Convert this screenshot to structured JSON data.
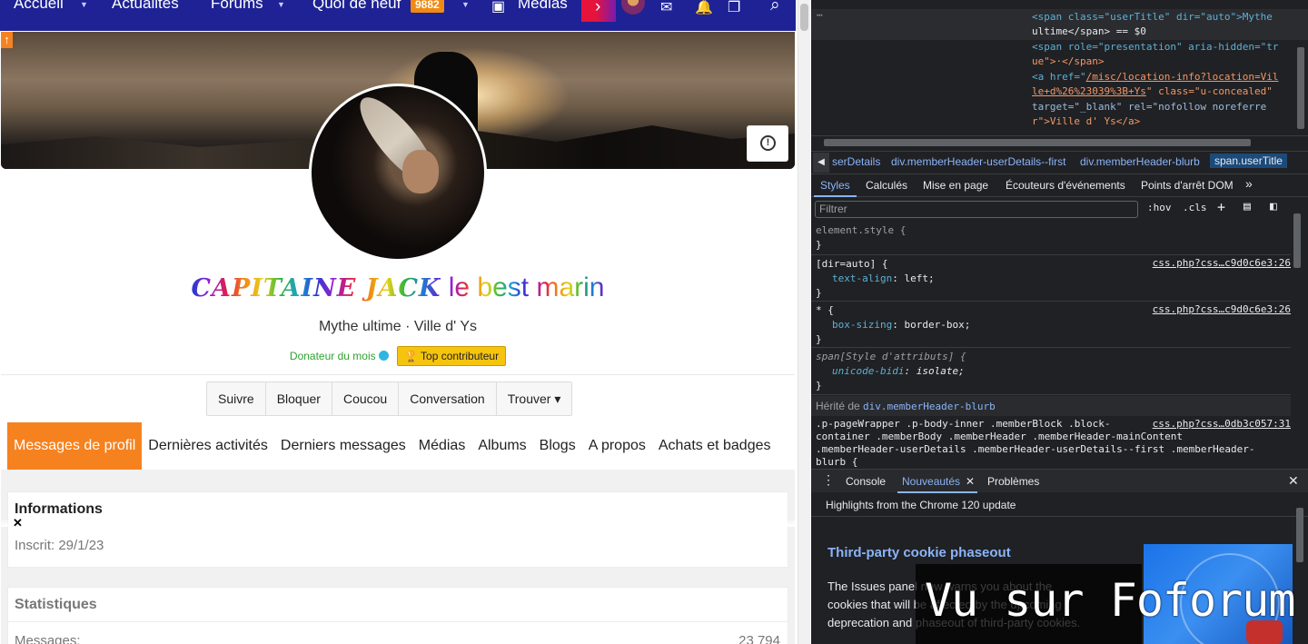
{
  "forum": {
    "nav": {
      "items": [
        "Accueil",
        "Actualités",
        "Forums",
        "Quoi de neuf",
        "Médias"
      ],
      "badge_count": "9882",
      "icons": [
        "media-icon",
        "next-arrow-icon",
        "user-avatar",
        "mail-icon",
        "bell-icon",
        "bookmark-icon",
        "search-icon"
      ],
      "accent_color": "#1e2294"
    },
    "profile": {
      "name_styled": "CAPITAINE JACK",
      "name_rest": " le best marin",
      "blurb": "Mythe ultime · Ville d' Ys",
      "banner_donor": "Donateur du mois",
      "banner_top": "🏆 Top contributeur",
      "report_icon": "report-icon"
    },
    "actions": [
      "Suivre",
      "Bloquer",
      "Coucou",
      "Conversation",
      "Trouver ▾"
    ],
    "tabs": [
      "Messages de profil",
      "Dernières activités",
      "Derniers messages",
      "Médias",
      "Albums",
      "Blogs",
      "A propos",
      "Achats et badges"
    ],
    "active_tab_color": "#f6821f",
    "info_block": {
      "title": "Informations",
      "row": "Inscrit: 29/1/23"
    },
    "stats_block": {
      "title": "Statistiques",
      "label": "Messages:",
      "value": "23 794"
    },
    "close_glyph": "✕"
  },
  "devtools": {
    "dom": {
      "line1": "<span class=\"userTitle\" dir=\"auto\">Mythe",
      "line2": "ultime</span> == $0",
      "line3": "<span role=\"presentation\" aria-hidden=\"tr",
      "line4": "ue\">·</span>",
      "line5a": "<a href=\"",
      "line5b": "/misc/location-info?location=Vil",
      "line6a": "le+d%26%23039%3B+Ys",
      "line6b": "\" class=\"u-concealed\"",
      "line7": "target=\"_blank\" rel=\"nofollow noreferre",
      "line8": "r\">Ville d' Ys</a>",
      "dots": "⋯"
    },
    "breadcrumbs": [
      "serDetails",
      "div.memberHeader-userDetails--first",
      "div.memberHeader-blurb",
      "span.userTitle"
    ],
    "style_tabs": [
      "Styles",
      "Calculés",
      "Mise en page",
      "Écouteurs d'événements",
      "Points d'arrêt DOM",
      "»"
    ],
    "filter_placeholder": "Filtrer",
    "filter_tools": [
      ":hov",
      ".cls",
      "+"
    ],
    "rules": {
      "r1_sel": "element.style {",
      "r1_end": "}",
      "r2_sel": "[dir=auto] {",
      "r2_prop": "text-align",
      "r2_val": "left;",
      "r2_src": "css.php?css…c9d0c6e3:26",
      "r3_sel": "* {",
      "r3_prop": "box-sizing",
      "r3_val": "border-box;",
      "r3_src": "css.php?css…c9d0c6e3:26",
      "r4_sel": "span[Style d'attributs] {",
      "r4_prop": "unicode-bidi",
      "r4_val": "isolate;",
      "inherited_label": "Hérité de ",
      "inherited_link": "div.memberHeader-blurb",
      "r5_l1": ".p-pageWrapper .p-body-inner .memberBlock .block-",
      "r5_l2": "container .memberBody .memberHeader .memberHeader-mainContent",
      "r5_l3": ".memberHeader-userDetails .memberHeader-userDetails--first .memberHeader-",
      "r5_l4": "blurb {",
      "r5_src": "css.php?css…0db3c057:31"
    },
    "drawer_tabs": [
      "Console",
      "Nouveautés",
      "Problèmes"
    ],
    "drawer_close": "✕",
    "whats_new_header": "Highlights from the Chrome 120 update",
    "whats_new_title": "Third-party cookie phaseout",
    "whats_new_lines": [
      "The Issues panel now warns you about the",
      "cookies that will be affected by the upcoming",
      "deprecation and phaseout of third-party cookies."
    ]
  },
  "watermark": "Vu sur Foforum"
}
